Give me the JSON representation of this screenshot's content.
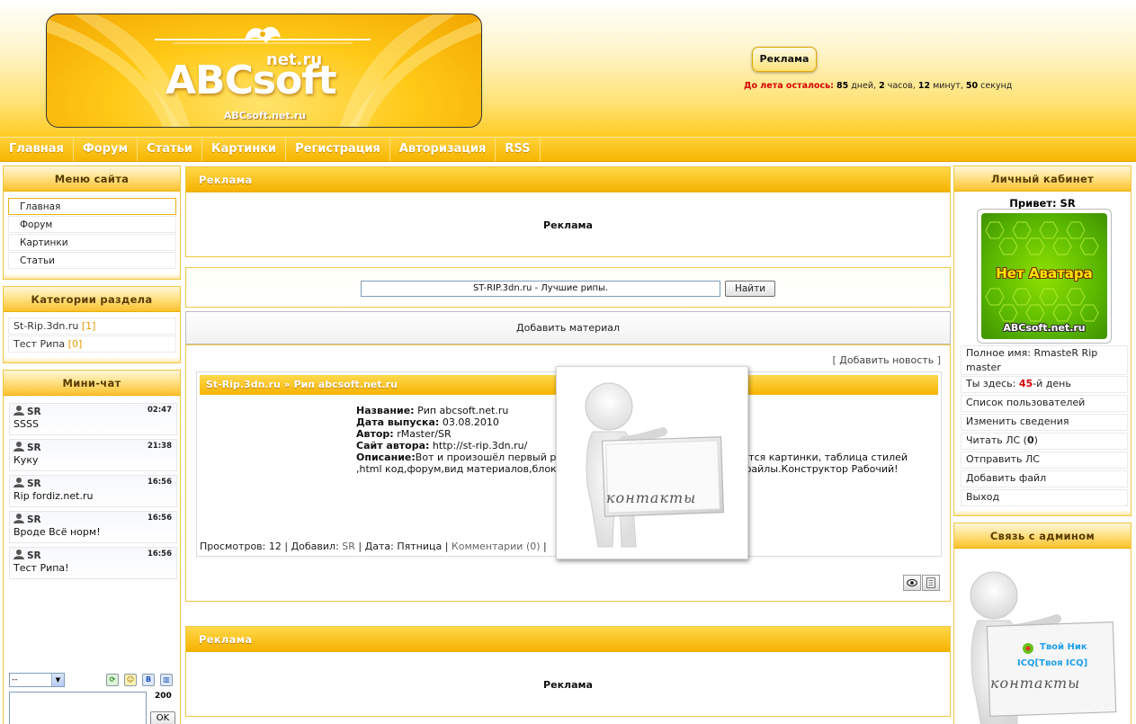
{
  "header": {
    "logo_main": "ABCsoft",
    "logo_sup": "net.ru",
    "logo_url": "ABCsoft.net.ru",
    "ad_button": "Реклама",
    "countdown": {
      "label": "До лета осталось:",
      "days": "85",
      "days_unit": "дней,",
      "hours": "2",
      "hours_unit": "часов,",
      "minutes": "12",
      "minutes_unit": "минут,",
      "seconds": "50",
      "seconds_unit": "секунд"
    }
  },
  "nav": [
    "Главная",
    "Форум",
    "Статьи",
    "Картинки",
    "Регистрация",
    "Авторизация",
    "RSS"
  ],
  "site_menu": {
    "title": "Меню сайта",
    "items": [
      "Главная",
      "Форум",
      "Картинки",
      "Статьи"
    ]
  },
  "categories": {
    "title": "Категории раздела",
    "items": [
      {
        "name": "St-Rip.3dn.ru",
        "count": "[1]"
      },
      {
        "name": "Тест Рипа",
        "count": "[0]"
      }
    ]
  },
  "mini_chat": {
    "title": "Мини-чат",
    "messages": [
      {
        "user": "SR",
        "time": "02:47",
        "text": "SSSS"
      },
      {
        "user": "SR",
        "time": "21:38",
        "text": "Куку"
      },
      {
        "user": "SR",
        "time": "16:56",
        "text": "Rip fordiz.net.ru"
      },
      {
        "user": "SR",
        "time": "16:56",
        "text": "Вроде Всё норм!"
      },
      {
        "user": "SR",
        "time": "16:56",
        "text": "Тест Рипа!"
      }
    ],
    "select_value": "--",
    "char_count": "200",
    "ok_label": "OK",
    "icon_b": "B"
  },
  "center": {
    "ad_top_title": "Реклама",
    "ad_top_text": "Реклама",
    "search_value": "ST-RIP.3dn.ru - Лучшие рипы.",
    "search_button": "Найти",
    "add_material": "Добавить материал",
    "add_news": "Добавить новость",
    "entry": {
      "title": "St-Rip.3dn.ru » Рип abcsoft.net.ru",
      "name_label": "Название:",
      "name_value": "Рип abcsoft.net.ru",
      "date_label": "Дата выпуска:",
      "date_value": "03.08.2010",
      "author_label": "Автор:",
      "author_value": "rMaster/SR",
      "site_label": "Сайт автора:",
      "site_value": "http://st-rip.3dn.ru/",
      "desc_label": "Описание:",
      "desc_line1_a": "Вот и произошёл первый р",
      "desc_line1_b": "дятся картинки, таблица стилей",
      "desc_line2_a": ",html код,форум,вид материалов,блок",
      "desc_line2_b": "файлы.Конструктор Рабочий!",
      "views_label": "Просмотров:",
      "views_value": "12",
      "added_label": "Добавил:",
      "added_value": "SR",
      "date2_label": "Дата:",
      "date2_value": "Пятница",
      "comments": "Комментарии (0)"
    },
    "popup_label": "контакты",
    "ad_bottom_title": "Реклама",
    "ad_bottom_text": "Реклама"
  },
  "cabinet": {
    "title": "Личный кабинет",
    "greeting": "Привет: SR",
    "avatar_title": "Нет Аватара",
    "avatar_url": "ABCsoft.net.ru",
    "full_name_label": "Полное имя:",
    "full_name_value": "RmasteR Rip master",
    "here_prefix": "Ты здесь:",
    "here_days": "45",
    "here_suffix": "-й день",
    "links": [
      "Список пользователей",
      "Изменить сведения"
    ],
    "read_pm_label": "Читать ЛС (",
    "read_pm_count": "0",
    "read_pm_close": ")",
    "links2": [
      "Отправить ЛС",
      "Добавить файл",
      "Выход"
    ]
  },
  "contact_admin": {
    "title": "Связь с админом",
    "nick": "Твой Ник",
    "icq": "ICQ[Твоя ICQ]",
    "label": "контакты"
  },
  "colors": {
    "accent": "#f7b500",
    "header_text": "#5a3b00",
    "alert_red": "#d40000"
  }
}
